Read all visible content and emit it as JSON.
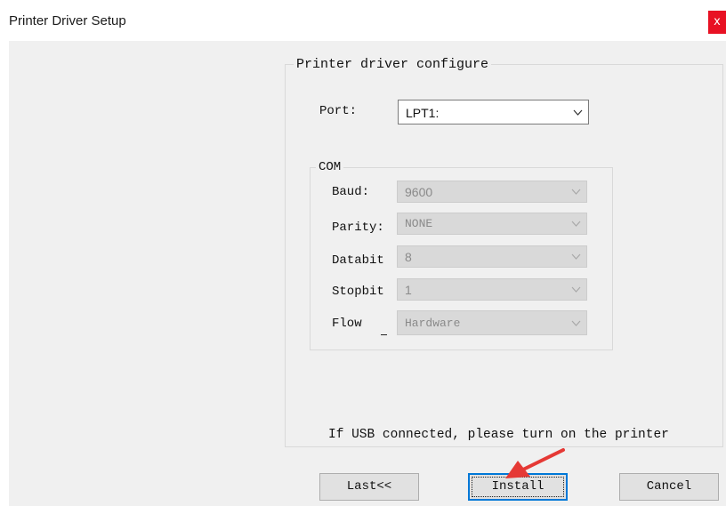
{
  "window": {
    "title": "Printer Driver Setup",
    "close_glyph": "x"
  },
  "driver_group": {
    "legend": "Printer driver configure",
    "port": {
      "label": "Port:",
      "value": "LPT1:"
    }
  },
  "com_group": {
    "legend": "COM",
    "fields": [
      {
        "label": "Baud:",
        "value": "9600"
      },
      {
        "label": "Parity:",
        "value": "NONE"
      },
      {
        "label": "Databit",
        "value": "8"
      },
      {
        "label": "Stopbit",
        "value": "1"
      },
      {
        "label": "Flow",
        "value": "Hardware"
      }
    ]
  },
  "notice": "If USB connected, please turn on the printer",
  "buttons": {
    "last": "Last<<",
    "install": "Install",
    "cancel": "Cancel"
  },
  "colors": {
    "close_bg": "#e81123",
    "arrow": "#e53935",
    "focus": "#0078d7",
    "client_bg": "#f0f0f0"
  }
}
